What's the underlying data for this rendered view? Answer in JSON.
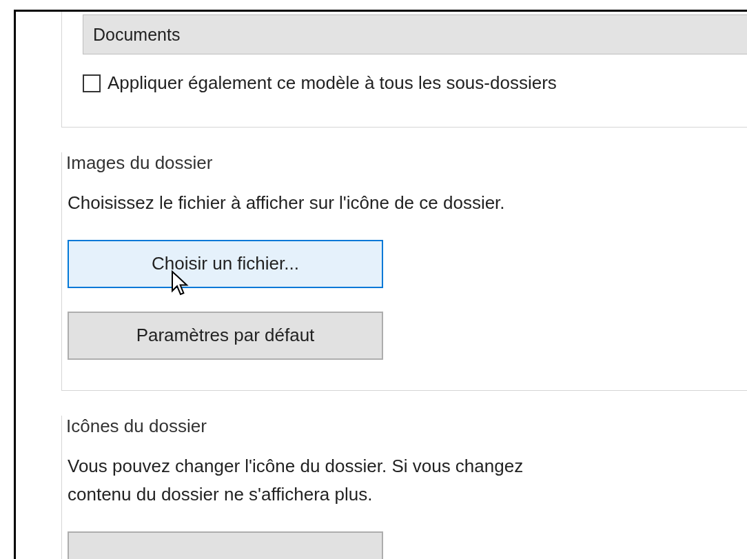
{
  "template_dropdown": {
    "value": "Documents"
  },
  "apply_checkbox": {
    "label": "Appliquer également ce modèle à tous les sous-dossiers",
    "checked": false
  },
  "sections": [
    {
      "title": "Images du dossier",
      "description": "Choisissez le fichier à afficher sur l'icône de ce dossier.",
      "buttons": [
        {
          "label": "Choisir un fichier...",
          "hovered": true
        },
        {
          "label": "Paramètres par défaut",
          "hovered": false
        }
      ]
    },
    {
      "title": "Icônes du dossier",
      "description_lines": [
        "Vous pouvez changer l'icône du dossier. Si vous changez",
        "contenu du dossier ne s'affichera plus."
      ],
      "buttons": [
        {
          "hovered": false
        }
      ]
    }
  ]
}
